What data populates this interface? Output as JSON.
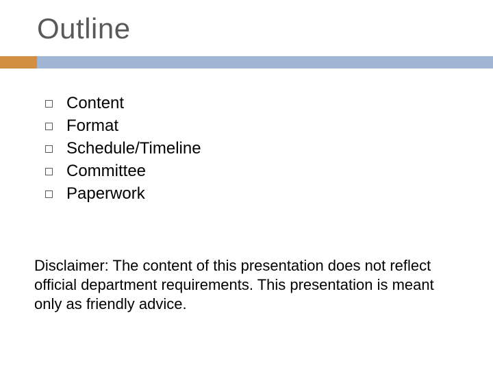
{
  "title": "Outline",
  "bullets": [
    {
      "label": "Content"
    },
    {
      "label": "Format"
    },
    {
      "label": "Schedule/Timeline"
    },
    {
      "label": "Committee"
    },
    {
      "label": "Paperwork"
    }
  ],
  "disclaimer": "Disclaimer: The content of this presentation does not reflect official department requirements. This presentation is meant only as friendly advice.",
  "colors": {
    "accent": "#d28f42",
    "bar": "#a1b6d4",
    "title": "#595959"
  }
}
